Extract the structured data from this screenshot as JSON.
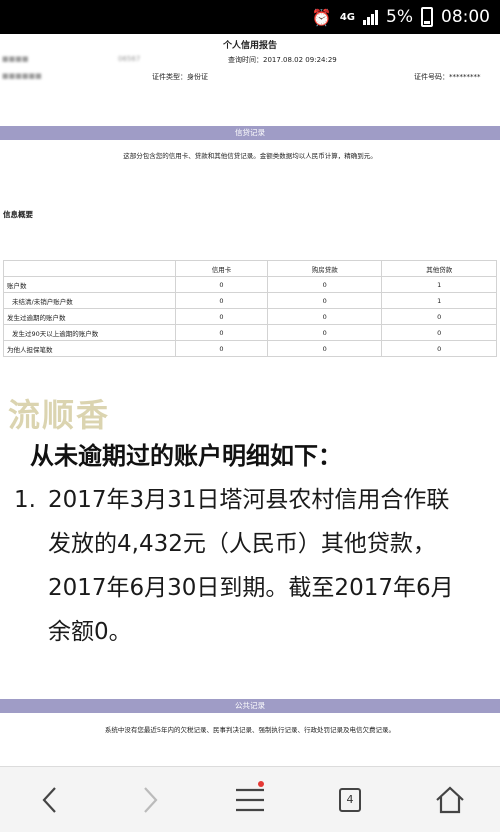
{
  "status_bar": {
    "network": "4G",
    "battery_percent": "5%",
    "time": "08:00"
  },
  "report": {
    "title": "个人信用报告",
    "query_time_label": "查询时间：",
    "query_time": "2017.08.02 09:24:29",
    "report_no_partial": "06567",
    "id_type": "证件类型：身份证",
    "id_number_label": "证件号码：",
    "id_number": "*********"
  },
  "credit_section": {
    "band_title": "信贷记录",
    "note": "这部分包含您的信用卡、贷款和其他信贷记录。金额类数据均以人民币计算，精确到元。",
    "overview_title": "信息概要",
    "columns": [
      "信用卡",
      "购房贷款",
      "其他贷款"
    ],
    "rows": [
      {
        "label": "账户数",
        "values": [
          "0",
          "0",
          "1"
        ]
      },
      {
        "label": "未结清/未销户账户数",
        "values": [
          "0",
          "0",
          "1"
        ]
      },
      {
        "label": "发生过逾期的账户数",
        "values": [
          "0",
          "0",
          "0"
        ]
      },
      {
        "label": "发生过90天以上逾期的账户数",
        "values": [
          "0",
          "0",
          "0"
        ]
      },
      {
        "label": "为他人担保笔数",
        "values": [
          "0",
          "0",
          "0"
        ]
      }
    ]
  },
  "detail": {
    "stamp_text": "流顺香",
    "headline": "从未逾期过的账户明细如下：",
    "item_number": "1.",
    "lines": [
      "2017年3月31日塔河县农村信用合作联",
      "发放的4,432元（人民币）其他贷款，",
      "2017年6月30日到期。截至2017年6月",
      "余额0。"
    ]
  },
  "public_section": {
    "band_title": "公共记录",
    "note": "系统中没有您最近5年内的欠税记录、民事判决记录、强制执行记录、行政处罚记录及电信欠费记录。"
  },
  "navbar": {
    "tabs_count": "4"
  }
}
